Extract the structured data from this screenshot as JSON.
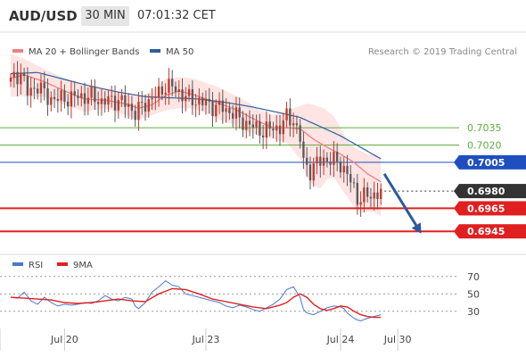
{
  "header": {
    "symbol": "AUD/USD",
    "timeframe": "30 MIN",
    "time": "07:01:32 CET"
  },
  "colors": {
    "candle_up": "#c0392b",
    "candle_down": "#5a5a5a",
    "ma20": "#f08080",
    "bollinger_fill": "#ffe4e4",
    "ma50": "#2c5f9e",
    "resistance": "#5faf3c",
    "pivot": "#1f4fbf",
    "support": "#e02020",
    "rsi": "#4a78d0",
    "rsi_ma": "#e02020",
    "arrow": "#2d5a9a",
    "current_label_bg": "#333333"
  },
  "chart_data": [
    {
      "type": "candlestick",
      "legend": [
        {
          "name": "MA 20 + Bollinger Bands",
          "color": "#f08080"
        },
        {
          "name": "MA 50",
          "color": "#2c5f9e"
        }
      ],
      "watermark": "Research © 2019 Trading Central",
      "ylim": [
        0.6925,
        0.7115
      ],
      "x_ticks": [
        {
          "label": "Jul 20",
          "x": 16
        },
        {
          "label": "Jul 23",
          "x": 58
        },
        {
          "label": "Jul 24",
          "x": 98
        },
        {
          "label": "Jul 30",
          "x": 115
        }
      ],
      "x_range": [
        0,
        120
      ],
      "levels": [
        {
          "value": 0.7035,
          "label": "0.7035",
          "kind": "resistance"
        },
        {
          "value": 0.702,
          "label": "0.7020",
          "kind": "resistance"
        },
        {
          "value": 0.7005,
          "label": "0.7005",
          "kind": "pivot"
        },
        {
          "value": 0.6965,
          "label": "0.6965",
          "kind": "support"
        },
        {
          "value": 0.6945,
          "label": "0.6945",
          "kind": "support"
        }
      ],
      "current_price": {
        "value": 0.698,
        "label": "0.6980"
      },
      "projection": {
        "from": [
          1,
          0.6995
        ],
        "to": [
          12,
          0.6943
        ]
      },
      "ohlc_anchors": [
        [
          0,
          0.7075
        ],
        [
          3,
          0.7084
        ],
        [
          5,
          0.7065
        ],
        [
          8,
          0.7072
        ],
        [
          11,
          0.7061
        ],
        [
          15,
          0.706
        ],
        [
          20,
          0.7062
        ],
        [
          24,
          0.7062
        ],
        [
          27,
          0.7058
        ],
        [
          32,
          0.7059
        ],
        [
          35,
          0.7054
        ],
        [
          37,
          0.7048
        ],
        [
          40,
          0.7056
        ],
        [
          42,
          0.7061
        ],
        [
          44,
          0.7064
        ],
        [
          46,
          0.7072
        ],
        [
          48,
          0.707
        ],
        [
          51,
          0.7064
        ],
        [
          53,
          0.706
        ],
        [
          56,
          0.7058
        ],
        [
          60,
          0.7054
        ],
        [
          63,
          0.7052
        ],
        [
          66,
          0.7048
        ],
        [
          68,
          0.7042
        ],
        [
          72,
          0.7036
        ],
        [
          75,
          0.7032
        ],
        [
          78,
          0.7035
        ],
        [
          80,
          0.7035
        ],
        [
          82,
          0.7044
        ],
        [
          84,
          0.7042
        ],
        [
          86,
          0.7025
        ],
        [
          87,
          0.7005
        ],
        [
          89,
          0.6998
        ],
        [
          91,
          0.7004
        ],
        [
          93,
          0.7008
        ],
        [
          96,
          0.7006
        ],
        [
          98,
          0.7004
        ],
        [
          100,
          0.6994
        ],
        [
          102,
          0.6982
        ],
        [
          103,
          0.6974
        ],
        [
          105,
          0.6975
        ],
        [
          108,
          0.6977
        ],
        [
          110,
          0.6979
        ]
      ],
      "ma20_anchors": [
        [
          0,
          0.7078
        ],
        [
          4,
          0.7081
        ],
        [
          10,
          0.7075
        ],
        [
          16,
          0.7067
        ],
        [
          22,
          0.706
        ],
        [
          28,
          0.7059
        ],
        [
          34,
          0.7056
        ],
        [
          38,
          0.7052
        ],
        [
          42,
          0.7055
        ],
        [
          46,
          0.7063
        ],
        [
          50,
          0.7067
        ],
        [
          54,
          0.7064
        ],
        [
          58,
          0.706
        ],
        [
          62,
          0.7056
        ],
        [
          66,
          0.7052
        ],
        [
          70,
          0.7046
        ],
        [
          74,
          0.704
        ],
        [
          78,
          0.7035
        ],
        [
          82,
          0.7035
        ],
        [
          86,
          0.7034
        ],
        [
          90,
          0.7025
        ],
        [
          94,
          0.7018
        ],
        [
          98,
          0.7012
        ],
        [
          102,
          0.7005
        ],
        [
          106,
          0.6995
        ],
        [
          110,
          0.6988
        ]
      ],
      "bollinger_upper_anchors": [
        [
          0,
          0.7099
        ],
        [
          3,
          0.7096
        ],
        [
          6,
          0.7092
        ],
        [
          10,
          0.7086
        ],
        [
          16,
          0.7078
        ],
        [
          22,
          0.7073
        ],
        [
          28,
          0.7068
        ],
        [
          34,
          0.7064
        ],
        [
          38,
          0.7062
        ],
        [
          42,
          0.7066
        ],
        [
          46,
          0.7078
        ],
        [
          50,
          0.7079
        ],
        [
          54,
          0.7078
        ],
        [
          58,
          0.7074
        ],
        [
          62,
          0.707
        ],
        [
          66,
          0.7064
        ],
        [
          70,
          0.7058
        ],
        [
          74,
          0.705
        ],
        [
          78,
          0.7046
        ],
        [
          82,
          0.705
        ],
        [
          86,
          0.7054
        ],
        [
          88,
          0.7056
        ],
        [
          90,
          0.7055
        ],
        [
          93,
          0.7052
        ],
        [
          96,
          0.7045
        ],
        [
          98,
          0.7035
        ],
        [
          100,
          0.7024
        ],
        [
          102,
          0.7018
        ],
        [
          104,
          0.7015
        ],
        [
          106,
          0.7012
        ],
        [
          108,
          0.7012
        ],
        [
          110,
          0.7008
        ]
      ],
      "bollinger_lower_anchors": [
        [
          0,
          0.7062
        ],
        [
          6,
          0.7062
        ],
        [
          10,
          0.7062
        ],
        [
          16,
          0.7055
        ],
        [
          22,
          0.7049
        ],
        [
          28,
          0.7052
        ],
        [
          34,
          0.7046
        ],
        [
          38,
          0.7042
        ],
        [
          42,
          0.7046
        ],
        [
          46,
          0.705
        ],
        [
          50,
          0.7052
        ],
        [
          54,
          0.7052
        ],
        [
          58,
          0.7048
        ],
        [
          62,
          0.7042
        ],
        [
          66,
          0.7038
        ],
        [
          70,
          0.7032
        ],
        [
          74,
          0.7028
        ],
        [
          78,
          0.7025
        ],
        [
          82,
          0.7022
        ],
        [
          86,
          0.7008
        ],
        [
          88,
          0.6992
        ],
        [
          90,
          0.6985
        ],
        [
          92,
          0.6982
        ],
        [
          94,
          0.699
        ],
        [
          96,
          0.6992
        ],
        [
          98,
          0.6983
        ],
        [
          100,
          0.6975
        ],
        [
          102,
          0.6966
        ],
        [
          104,
          0.6962
        ],
        [
          106,
          0.6962
        ],
        [
          108,
          0.6962
        ],
        [
          110,
          0.6958
        ]
      ],
      "ma50_anchors": [
        [
          0,
          0.7082
        ],
        [
          8,
          0.7083
        ],
        [
          16,
          0.7077
        ],
        [
          24,
          0.7071
        ],
        [
          32,
          0.7066
        ],
        [
          40,
          0.7062
        ],
        [
          48,
          0.7061
        ],
        [
          56,
          0.706
        ],
        [
          64,
          0.7057
        ],
        [
          72,
          0.7053
        ],
        [
          80,
          0.7048
        ],
        [
          86,
          0.7044
        ],
        [
          92,
          0.7036
        ],
        [
          98,
          0.7028
        ],
        [
          104,
          0.7018
        ],
        [
          110,
          0.7008
        ]
      ]
    },
    {
      "type": "line",
      "title": "RSI",
      "series": [
        {
          "name": "RSI",
          "color": "#4a78d0",
          "points": [
            [
              0,
              46
            ],
            [
              2,
              45
            ],
            [
              4,
              52
            ],
            [
              6,
              42
            ],
            [
              8,
              38
            ],
            [
              10,
              46
            ],
            [
              12,
              40
            ],
            [
              14,
              36
            ],
            [
              16,
              38
            ],
            [
              18,
              37
            ],
            [
              20,
              38
            ],
            [
              22,
              40
            ],
            [
              24,
              39
            ],
            [
              26,
              42
            ],
            [
              28,
              48
            ],
            [
              30,
              44
            ],
            [
              32,
              42
            ],
            [
              34,
              46
            ],
            [
              36,
              44
            ],
            [
              37,
              36
            ],
            [
              38,
              33
            ],
            [
              40,
              40
            ],
            [
              42,
              52
            ],
            [
              44,
              58
            ],
            [
              46,
              65
            ],
            [
              48,
              60
            ],
            [
              50,
              58
            ],
            [
              52,
              50
            ],
            [
              54,
              48
            ],
            [
              56,
              46
            ],
            [
              58,
              44
            ],
            [
              60,
              42
            ],
            [
              62,
              40
            ],
            [
              64,
              36
            ],
            [
              66,
              34
            ],
            [
              68,
              37
            ],
            [
              70,
              35
            ],
            [
              72,
              32
            ],
            [
              74,
              30
            ],
            [
              76,
              34
            ],
            [
              78,
              38
            ],
            [
              80,
              44
            ],
            [
              82,
              55
            ],
            [
              84,
              58
            ],
            [
              86,
              46
            ],
            [
              87,
              32
            ],
            [
              88,
              28
            ],
            [
              90,
              26
            ],
            [
              92,
              30
            ],
            [
              94,
              34
            ],
            [
              96,
              36
            ],
            [
              98,
              35
            ],
            [
              99,
              33
            ],
            [
              100,
              28
            ],
            [
              102,
              22
            ],
            [
              103,
              20
            ],
            [
              104,
              19
            ],
            [
              106,
              22
            ],
            [
              108,
              24
            ],
            [
              110,
              26
            ]
          ]
        },
        {
          "name": "9MA",
          "color": "#e02020",
          "points": [
            [
              0,
              46
            ],
            [
              4,
              45
            ],
            [
              8,
              44
            ],
            [
              12,
              43
            ],
            [
              16,
              40
            ],
            [
              20,
              39
            ],
            [
              24,
              40
            ],
            [
              28,
              42
            ],
            [
              32,
              44
            ],
            [
              36,
              42
            ],
            [
              40,
              41
            ],
            [
              44,
              50
            ],
            [
              48,
              56
            ],
            [
              52,
              55
            ],
            [
              56,
              50
            ],
            [
              60,
              44
            ],
            [
              64,
              41
            ],
            [
              68,
              38
            ],
            [
              72,
              35
            ],
            [
              76,
              33
            ],
            [
              80,
              37
            ],
            [
              82,
              40
            ],
            [
              84,
              46
            ],
            [
              86,
              50
            ],
            [
              88,
              46
            ],
            [
              90,
              38
            ],
            [
              92,
              33
            ],
            [
              94,
              31
            ],
            [
              96,
              33
            ],
            [
              98,
              36
            ],
            [
              100,
              35
            ],
            [
              102,
              30
            ],
            [
              104,
              26
            ],
            [
              106,
              24
            ],
            [
              108,
              23
            ],
            [
              110,
              23
            ]
          ]
        }
      ],
      "ylim": [
        0,
        80
      ],
      "y_ticks": [
        70,
        50,
        30
      ],
      "reference_lines": [
        70,
        50,
        30
      ]
    }
  ]
}
